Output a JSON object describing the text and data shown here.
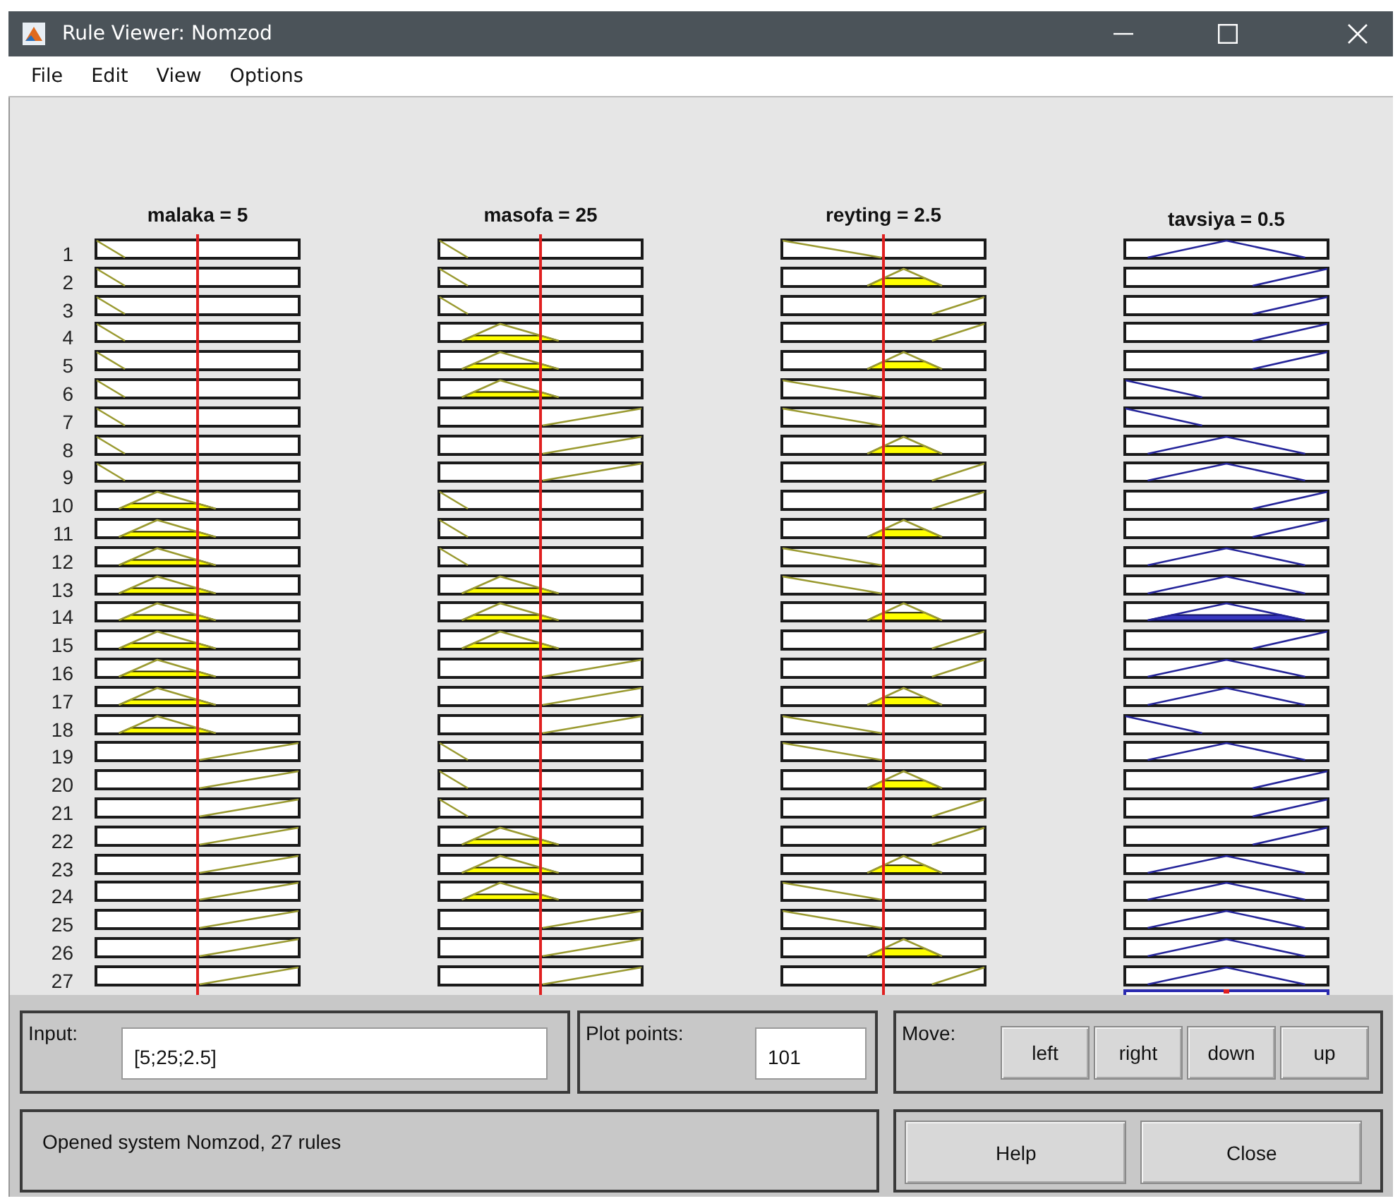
{
  "window": {
    "title": "Rule Viewer: Nomzod"
  },
  "menu": [
    "File",
    "Edit",
    "View",
    "Options"
  ],
  "variables": [
    {
      "label": "malaka = 5",
      "kind": "input"
    },
    {
      "label": "masofa = 25",
      "kind": "input"
    },
    {
      "label": "reyting = 2.5",
      "kind": "input"
    },
    {
      "label": "tavsiya = 0.5",
      "kind": "output"
    }
  ],
  "rules": [
    {
      "number": "1",
      "plots": [
        {
          "kind": "low"
        },
        {
          "kind": "low"
        },
        {
          "kind": "low"
        },
        {
          "kind": "mid"
        }
      ]
    },
    {
      "number": "2",
      "plots": [
        {
          "kind": "low"
        },
        {
          "kind": "low"
        },
        {
          "kind": "mid"
        },
        {
          "kind": "high"
        }
      ]
    },
    {
      "number": "3",
      "plots": [
        {
          "kind": "low"
        },
        {
          "kind": "low"
        },
        {
          "kind": "high"
        },
        {
          "kind": "high"
        }
      ]
    },
    {
      "number": "4",
      "plots": [
        {
          "kind": "low"
        },
        {
          "kind": "mid"
        },
        {
          "kind": "high"
        },
        {
          "kind": "high"
        }
      ]
    },
    {
      "number": "5",
      "plots": [
        {
          "kind": "low"
        },
        {
          "kind": "mid"
        },
        {
          "kind": "mid"
        },
        {
          "kind": "high"
        }
      ]
    },
    {
      "number": "6",
      "plots": [
        {
          "kind": "low"
        },
        {
          "kind": "mid"
        },
        {
          "kind": "low"
        },
        {
          "kind": "low"
        }
      ]
    },
    {
      "number": "7",
      "plots": [
        {
          "kind": "low"
        },
        {
          "kind": "high"
        },
        {
          "kind": "low"
        },
        {
          "kind": "low"
        }
      ]
    },
    {
      "number": "8",
      "plots": [
        {
          "kind": "low"
        },
        {
          "kind": "high"
        },
        {
          "kind": "mid"
        },
        {
          "kind": "mid"
        }
      ]
    },
    {
      "number": "9",
      "plots": [
        {
          "kind": "low"
        },
        {
          "kind": "high"
        },
        {
          "kind": "high"
        },
        {
          "kind": "mid"
        }
      ]
    },
    {
      "number": "10",
      "plots": [
        {
          "kind": "mid"
        },
        {
          "kind": "low"
        },
        {
          "kind": "high"
        },
        {
          "kind": "high"
        }
      ]
    },
    {
      "number": "11",
      "plots": [
        {
          "kind": "mid"
        },
        {
          "kind": "low"
        },
        {
          "kind": "mid"
        },
        {
          "kind": "high"
        }
      ]
    },
    {
      "number": "12",
      "plots": [
        {
          "kind": "mid"
        },
        {
          "kind": "low"
        },
        {
          "kind": "low"
        },
        {
          "kind": "mid"
        }
      ]
    },
    {
      "number": "13",
      "plots": [
        {
          "kind": "mid"
        },
        {
          "kind": "mid"
        },
        {
          "kind": "low"
        },
        {
          "kind": "mid"
        }
      ]
    },
    {
      "number": "14",
      "plots": [
        {
          "kind": "mid"
        },
        {
          "kind": "mid"
        },
        {
          "kind": "mid"
        },
        {
          "kind": "mid"
        }
      ]
    },
    {
      "number": "15",
      "plots": [
        {
          "kind": "mid"
        },
        {
          "kind": "mid"
        },
        {
          "kind": "high"
        },
        {
          "kind": "high"
        }
      ]
    },
    {
      "number": "16",
      "plots": [
        {
          "kind": "mid"
        },
        {
          "kind": "high"
        },
        {
          "kind": "high"
        },
        {
          "kind": "mid"
        }
      ]
    },
    {
      "number": "17",
      "plots": [
        {
          "kind": "mid"
        },
        {
          "kind": "high"
        },
        {
          "kind": "mid"
        },
        {
          "kind": "mid"
        }
      ]
    },
    {
      "number": "18",
      "plots": [
        {
          "kind": "mid"
        },
        {
          "kind": "high"
        },
        {
          "kind": "low"
        },
        {
          "kind": "low"
        }
      ]
    },
    {
      "number": "19",
      "plots": [
        {
          "kind": "high"
        },
        {
          "kind": "low"
        },
        {
          "kind": "low"
        },
        {
          "kind": "mid"
        }
      ]
    },
    {
      "number": "20",
      "plots": [
        {
          "kind": "high"
        },
        {
          "kind": "low"
        },
        {
          "kind": "mid"
        },
        {
          "kind": "high"
        }
      ]
    },
    {
      "number": "21",
      "plots": [
        {
          "kind": "high"
        },
        {
          "kind": "low"
        },
        {
          "kind": "high"
        },
        {
          "kind": "high"
        }
      ]
    },
    {
      "number": "22",
      "plots": [
        {
          "kind": "high"
        },
        {
          "kind": "mid"
        },
        {
          "kind": "high"
        },
        {
          "kind": "high"
        }
      ]
    },
    {
      "number": "23",
      "plots": [
        {
          "kind": "high"
        },
        {
          "kind": "mid"
        },
        {
          "kind": "mid"
        },
        {
          "kind": "mid"
        }
      ]
    },
    {
      "number": "24",
      "plots": [
        {
          "kind": "high"
        },
        {
          "kind": "mid"
        },
        {
          "kind": "low"
        },
        {
          "kind": "mid"
        }
      ]
    },
    {
      "number": "25",
      "plots": [
        {
          "kind": "high"
        },
        {
          "kind": "high"
        },
        {
          "kind": "low"
        },
        {
          "kind": "mid"
        }
      ]
    },
    {
      "number": "26",
      "plots": [
        {
          "kind": "high"
        },
        {
          "kind": "high"
        },
        {
          "kind": "mid"
        },
        {
          "kind": "mid"
        }
      ]
    },
    {
      "number": "27",
      "plots": [
        {
          "kind": "high"
        },
        {
          "kind": "high"
        },
        {
          "kind": "high"
        },
        {
          "kind": "mid"
        }
      ]
    }
  ],
  "input": {
    "label": "Input:",
    "value": "[5;25;2.5]"
  },
  "plot_points": {
    "label": "Plot points:",
    "value": "101"
  },
  "move": {
    "label": "Move:",
    "buttons": [
      "left",
      "right",
      "down",
      "up"
    ]
  },
  "status": "Opened system Nomzod, 27 rules",
  "buttons": [
    "Help",
    "Close"
  ]
}
